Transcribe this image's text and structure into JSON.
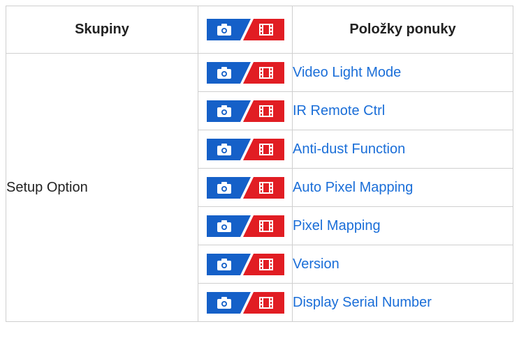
{
  "table": {
    "headers": {
      "group": "Skupiny",
      "items": "Položky ponuky"
    },
    "mode_badge": {
      "icons": [
        "camera-icon",
        "movie-icon"
      ],
      "photo_color": "#1560c8",
      "movie_color": "#e11d23"
    },
    "group_name": "Setup Option",
    "rows": [
      {
        "item": "Video Light Mode"
      },
      {
        "item": "IR Remote Ctrl"
      },
      {
        "item": "Anti-dust Function"
      },
      {
        "item": "Auto Pixel Mapping"
      },
      {
        "item": "Pixel Mapping"
      },
      {
        "item": "Version"
      },
      {
        "item": "Display Serial Number"
      }
    ],
    "link_color": "#1a6ed8"
  }
}
